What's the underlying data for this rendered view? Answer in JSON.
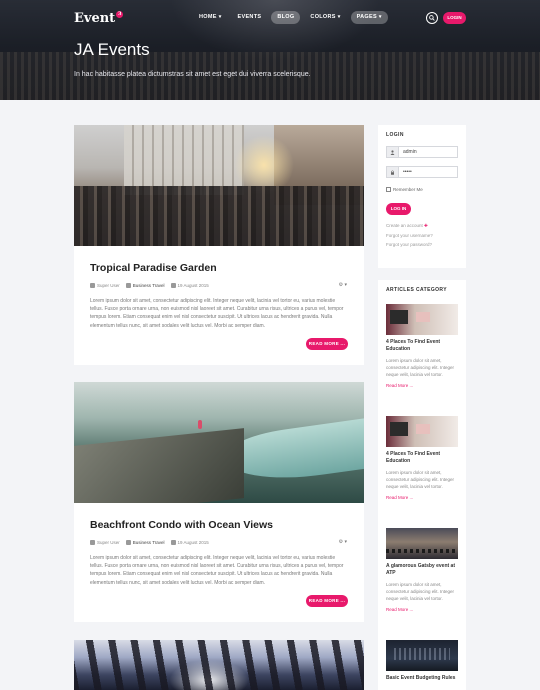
{
  "brand": {
    "name": "Event",
    "badge": "3"
  },
  "nav": {
    "items": [
      {
        "label": "HOME",
        "dropdown": true,
        "active": false
      },
      {
        "label": "EVENTS",
        "dropdown": false,
        "active": false
      },
      {
        "label": "BLOG",
        "dropdown": false,
        "active": true
      },
      {
        "label": "COLORS",
        "dropdown": true,
        "active": false
      },
      {
        "label": "PAGES",
        "dropdown": true,
        "active": true
      }
    ],
    "caret": "▾",
    "login_label": "LOGIN"
  },
  "hero": {
    "title": "JA Events",
    "subtitle": "In hac habitasse platea dictumstras sit amet est eget dui viverra scelerisque."
  },
  "posts": [
    {
      "title": "Tropical Paradise Garden",
      "author": "Super User",
      "category": "Business Travel",
      "date": "19 August 2015",
      "tools": "⚙ ▾",
      "excerpt": "Lorem ipsum dolor sit amet, consectetur adipiscing elit. Integer neque velit, lacinia vel tortor eu, varius molestie tellus. Fusce porta ornare urna, non euismod nisl laoreet sit amet. Curabitur urna risus, ultrices a purus vel, tempor tempus lorem. Etiam consequat enim vel nisl consectetur suscipit. Ut ultrices lacus ac hendrerit gravida. Nulla elementum tellus nunc, sit amet sodales velit luctus vel. Morbi ac semper diam.",
      "more": "READ MORE ..."
    },
    {
      "title": "Beachfront Condo with Ocean Views",
      "author": "Super User",
      "category": "Business Travel",
      "date": "19 August 2015",
      "tools": "⚙ ▾",
      "excerpt": "Lorem ipsum dolor sit amet, consectetur adipiscing elit. Integer neque velit, lacinia vel tortor eu, varius molestie tellus. Fusce porta ornare urna, non euismod nisl laoreet sit amet. Curabitur urna risus, ultrices a purus vel, tempor tempus lorem. Etiam consequat enim vel nisl consectetur suscipit. Ut ultrices lacus ac hendrerit gravida. Nulla elementum tellus nunc, sit amet sodales velit luctus vel. Morbi ac semper diam.",
      "more": "READ MORE ..."
    }
  ],
  "login": {
    "heading": "LOGIN",
    "username_value": "admin",
    "password_value": "•••••",
    "remember_label": "Remember Me",
    "submit_label": "LOG IN",
    "create_account": "Create an account",
    "create_plus": "✚",
    "forgot_username": "Forgot your username?",
    "forgot_password": "Forgot your password?"
  },
  "articles_category": {
    "heading": "ARTICLES CATEGORY",
    "items": [
      {
        "title": "4 Places To Find Event Education",
        "desc": "Lorem ipsum dolor sit amet, consectetur adipiscing elit. Integer neque velit, lacinia vel tortor.",
        "more": "Read More ..."
      },
      {
        "title": "4 Places To Find Event Education",
        "desc": "Lorem ipsum dolor sit amet, consectetur adipiscing elit. Integer neque velit, lacinia vel tortor.",
        "more": "Read More ..."
      },
      {
        "title": "A glamorous Gatsby event at ATP",
        "desc": "Lorem ipsum dolor sit amet, consectetur adipiscing elit. Integer neque velit, lacinia vel tortor.",
        "more": "Read More ..."
      },
      {
        "title": "Basic Event Budgeting Rules",
        "desc": "",
        "more": ""
      }
    ]
  },
  "colors": {
    "accent": "#e8196b"
  }
}
